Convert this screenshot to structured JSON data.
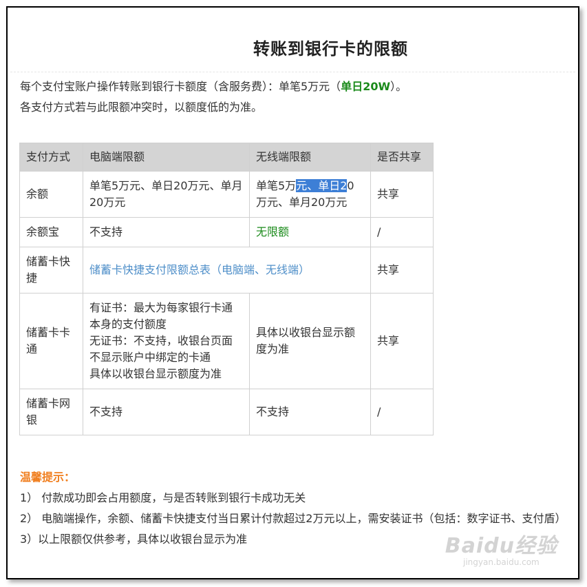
{
  "page": {
    "title": "转账到银行卡的限额",
    "intro_line1_prefix": "每个支付宝账户操作转账到银行卡额度（含服务费）：单笔5万元（",
    "intro_line1_highlight": "单日20W",
    "intro_line1_suffix": "）。",
    "intro_line2": "各支付方式若与此限额冲突时，以额度低的为准。"
  },
  "table": {
    "headers": [
      "支付方式",
      "电脑端限额",
      "无线端限额",
      "是否共享"
    ],
    "rows": [
      {
        "method": "余额",
        "pc": "单笔5万元、单日20万元、单月20万元",
        "mobile_a": "单笔5万",
        "mobile_sel": "元、单日2",
        "mobile_b": "0万元、单月20万元",
        "shared": "共享"
      },
      {
        "method": "余额宝",
        "pc": "不支持",
        "mobile": "无限额",
        "shared": "/"
      },
      {
        "method": "储蓄卡快捷",
        "merged_link": "储蓄卡快捷支付限额总表（电脑端、无线端）",
        "shared": "共享"
      },
      {
        "method": "储蓄卡卡通",
        "pc_line1": "有证书：最大为每家银行卡通本身的支付额度",
        "pc_line2": "无证书：不支持，收银台页面不显示账户中绑定的卡通",
        "pc_line3": "具体以收银台显示额度为准",
        "mobile": "具体以收银台显示额度为准",
        "shared": "共享"
      },
      {
        "method": "储蓄卡网银",
        "pc": "不支持",
        "mobile": "不支持",
        "shared": "/"
      }
    ]
  },
  "tips": {
    "title": "温馨提示：",
    "items": [
      "1） 付款成功即会占用额度，与是否转账到银行卡成功无关",
      "2） 电脑端操作，余额、储蓄卡快捷支付当日累计付款超过2万元以上，需安装证书（包括：数字证书、支付盾）",
      "3）以上限额仅供参考，具体以收银台显示为准"
    ]
  },
  "watermark": {
    "main": "Baidu经验",
    "sub": "jingyan.baidu.com"
  },
  "colors": {
    "accent_green": "#1a8a1a",
    "link_blue": "#4f8fc9",
    "tip_orange": "#f07e1e",
    "header_gray": "#d4d4d4",
    "selection_blue": "#3d7fd6"
  }
}
